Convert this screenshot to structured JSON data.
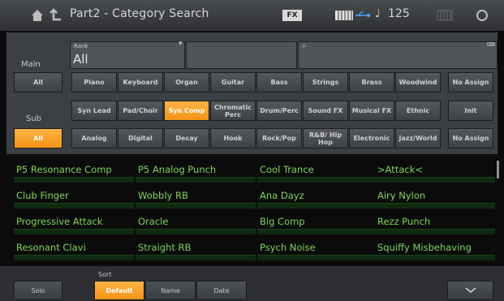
{
  "header": {
    "title": "Part2 - Category Search",
    "fx_badge": "FX",
    "tempo": "125"
  },
  "rank": {
    "caption": "Rank",
    "value": "All"
  },
  "rows": {
    "main_label": "Main",
    "sub_label": "Sub"
  },
  "main_categories": [
    "All",
    "Piano",
    "Keyboard",
    "Organ",
    "Guitar",
    "Bass",
    "Strings",
    "Brass",
    "Woodwind",
    "No Assign"
  ],
  "main_categories_2": [
    "Syn Lead",
    "Pad/Choir",
    "Syn Comp",
    "Chromatic Perc",
    "Drum/Perc",
    "Sound FX",
    "Musical FX",
    "Ethnic",
    "Init"
  ],
  "sub_categories": [
    "All",
    "Analog",
    "Digital",
    "Decay",
    "Hook",
    "Rock/Pop",
    "R&B/ Hip Hop",
    "Electronic",
    "Jazz/World",
    "No Assign"
  ],
  "results": [
    "P5 Resonance Comp",
    "P5 Analog Punch",
    "Cool Trance",
    ">Attack<",
    "Club Finger",
    "Wobbly RB",
    "Ana Dayz",
    "Airy Nylon",
    "Progressive Attack",
    "Oracle",
    "Big Comp",
    "Rezz Punch",
    "Resonant Clavi",
    "Straight RB",
    "Psych Noise",
    "Squiffy Misbehaving"
  ],
  "bottom": {
    "solo": "Solo",
    "sort_label": "Sort",
    "sort_default": "Default",
    "sort_name": "Name",
    "sort_date": "Date"
  },
  "colors": {
    "accent": "#f39415",
    "result_text": "#7fd45c"
  }
}
